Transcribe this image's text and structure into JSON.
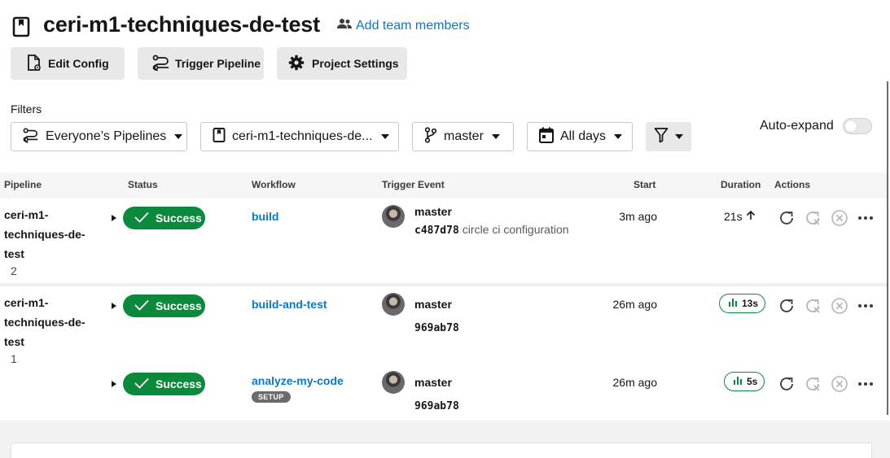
{
  "header": {
    "title": "ceri-m1-techniques-de-test",
    "add_team": "Add team members"
  },
  "toolbar": {
    "edit_config": "Edit Config",
    "trigger_pipeline": "Trigger Pipeline",
    "project_settings": "Project Settings"
  },
  "filters": {
    "label": "Filters",
    "pipelines": "Everyone’s Pipelines",
    "project": "ceri-m1-techniques-de...",
    "branch": "master",
    "days": "All days",
    "auto_expand": "Auto-expand"
  },
  "table": {
    "columns": [
      "Pipeline",
      "Status",
      "Workflow",
      "Trigger Event",
      "Start",
      "Duration",
      "Actions"
    ],
    "rows": [
      {
        "pipeline_line1": "ceri-m1-",
        "pipeline_line2": "techniques-de-",
        "pipeline_line3": "test",
        "pipeline_number": "2",
        "status": "Success",
        "workflow": "build",
        "branch": "master",
        "commit_sha": "c487d78",
        "commit_msg": "circle ci configuration",
        "start": "3m ago",
        "duration": "21s"
      },
      {
        "pipeline_line1": "ceri-m1-",
        "pipeline_line2": "techniques-de-",
        "pipeline_line3": "test",
        "pipeline_number": "1",
        "status": "Success",
        "workflow": "build-and-test",
        "branch": "master",
        "commit_sha": "969ab78",
        "start": "26m ago",
        "duration": "13s"
      },
      {
        "status": "Success",
        "workflow": "analyze-my-code",
        "workflow_tag": "SETUP",
        "branch": "master",
        "commit_sha": "969ab78",
        "start": "26m ago",
        "duration": "5s"
      }
    ]
  },
  "colors": {
    "success": "#0b8a3d",
    "link": "#0a78c8",
    "button_bg": "#e8e8e8"
  },
  "icons": {
    "project": "bookmark-file-icon",
    "team": "people-icon",
    "rerun": "rerun-icon",
    "rerun_failed": "rerun-failed-icon",
    "cancel": "cancel-icon",
    "more": "more-icon"
  }
}
